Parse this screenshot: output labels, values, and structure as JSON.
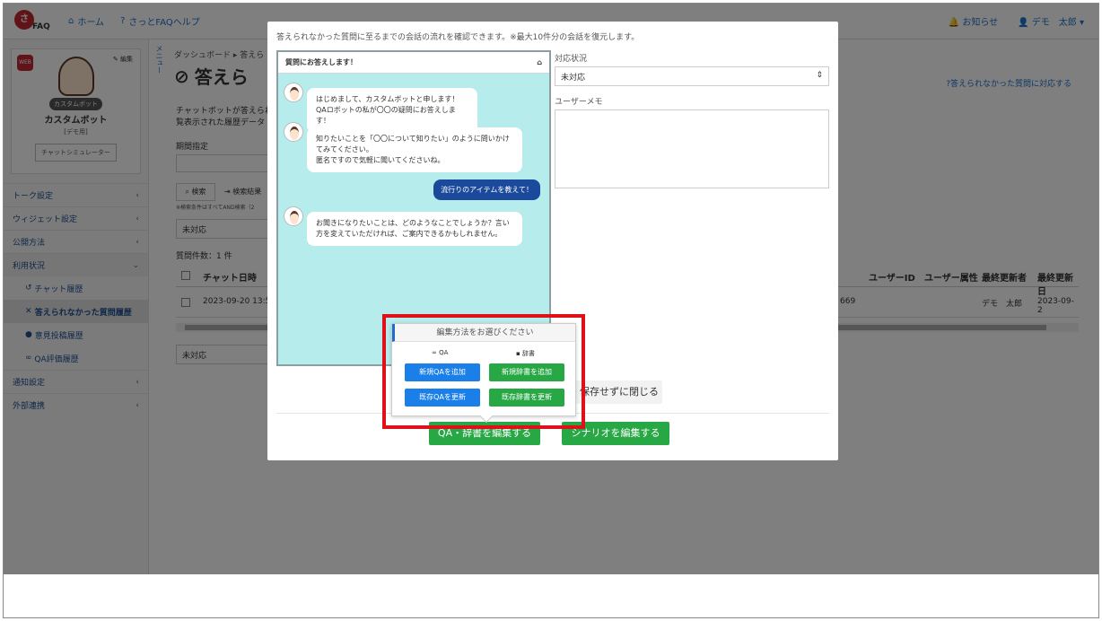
{
  "topnav": {
    "logo_text": "FAQ",
    "home": "ホーム",
    "help": "さっとFAQヘルプ",
    "notice": "お知らせ",
    "user": "デモ　太郎"
  },
  "sidebar": {
    "web_badge": "WEB",
    "edit": "編集",
    "bot_pill": "カスタムボット",
    "bot_name": "カスタムボット",
    "bot_sub": "[デモ用]",
    "simulator": "チャットシミュレーター",
    "items": [
      {
        "label": "トーク設定"
      },
      {
        "label": "ウィジェット設定"
      },
      {
        "label": "公開方法"
      },
      {
        "label": "利用状況"
      }
    ],
    "subitems": [
      {
        "label": "チャット履歴"
      },
      {
        "label": "答えられなかった質問履歴"
      },
      {
        "label": "意見投稿履歴"
      },
      {
        "label": "QA評価履歴"
      }
    ],
    "items2": [
      {
        "label": "通知設定"
      },
      {
        "label": "外部連携"
      }
    ]
  },
  "main": {
    "menu": "メニュー",
    "breadcrumb": "ダッシュボード ▸ 答えら",
    "title": "答えら",
    "desc": "チャットボットが答えられ 一覧表示された履歴データ",
    "period": "期間指定",
    "search": "検索",
    "export": "検索結果",
    "note": "※検索条件はすべてAND検索（2",
    "status": "未対応",
    "count": "質問件数：1 件",
    "help_link": "答えられなかった質問に対応する",
    "columns": {
      "date": "チャット日時",
      "uid": "ユーザーID",
      "uattr": "ユーザー属性",
      "editor": "最終更新者",
      "updated": "最終更新日"
    },
    "row": {
      "date": "2023-09-20 13:5",
      "id": "669",
      "editor": "デモ　太郎",
      "updated": "2023-09-2"
    },
    "status2": "未対応"
  },
  "modal": {
    "top_text": "答えられなかった質問に至るまでの会話の流れを確認できます。※最大10件分の会話を復元します。",
    "chat_title": "質問にお答えします！",
    "messages": {
      "m1": "はじめまして、カスタムボットと申します！\nQAロボットの私が〇〇の疑問にお答えします！",
      "m2": "知りたいことを「〇〇について知りたい」のように問いかけてみてください。\n匿名ですので気軽に聞いてくださいね。",
      "user": "流行りのアイテムを教えて！",
      "m3": "お聞きになりたいことは、どのようなことでしょうか？言い方を変えていただければ、ご案内できるかもしれません。"
    },
    "status_label": "対応状況",
    "status_value": "未対応",
    "memo_label": "ユーザーメモ",
    "close_button": "保存せずに閉じる",
    "qa_edit_button": "QA・辞書を編集する",
    "scenario_button": "シナリオを編集する"
  },
  "popover": {
    "header": "編集方法をお選びください",
    "qa_label": "QA",
    "dict_label": "辞書",
    "new_qa": "新規QAを追加",
    "new_dict": "新規辞書を追加",
    "update_qa": "既存QAを更新",
    "update_dict": "既存辞書を更新"
  },
  "colors": {
    "accent": "#1e6ec8",
    "green": "#28a745",
    "highlight": "#e0101a",
    "chat_bg": "#b7ecec",
    "user_bubble": "#1b4a9c"
  }
}
